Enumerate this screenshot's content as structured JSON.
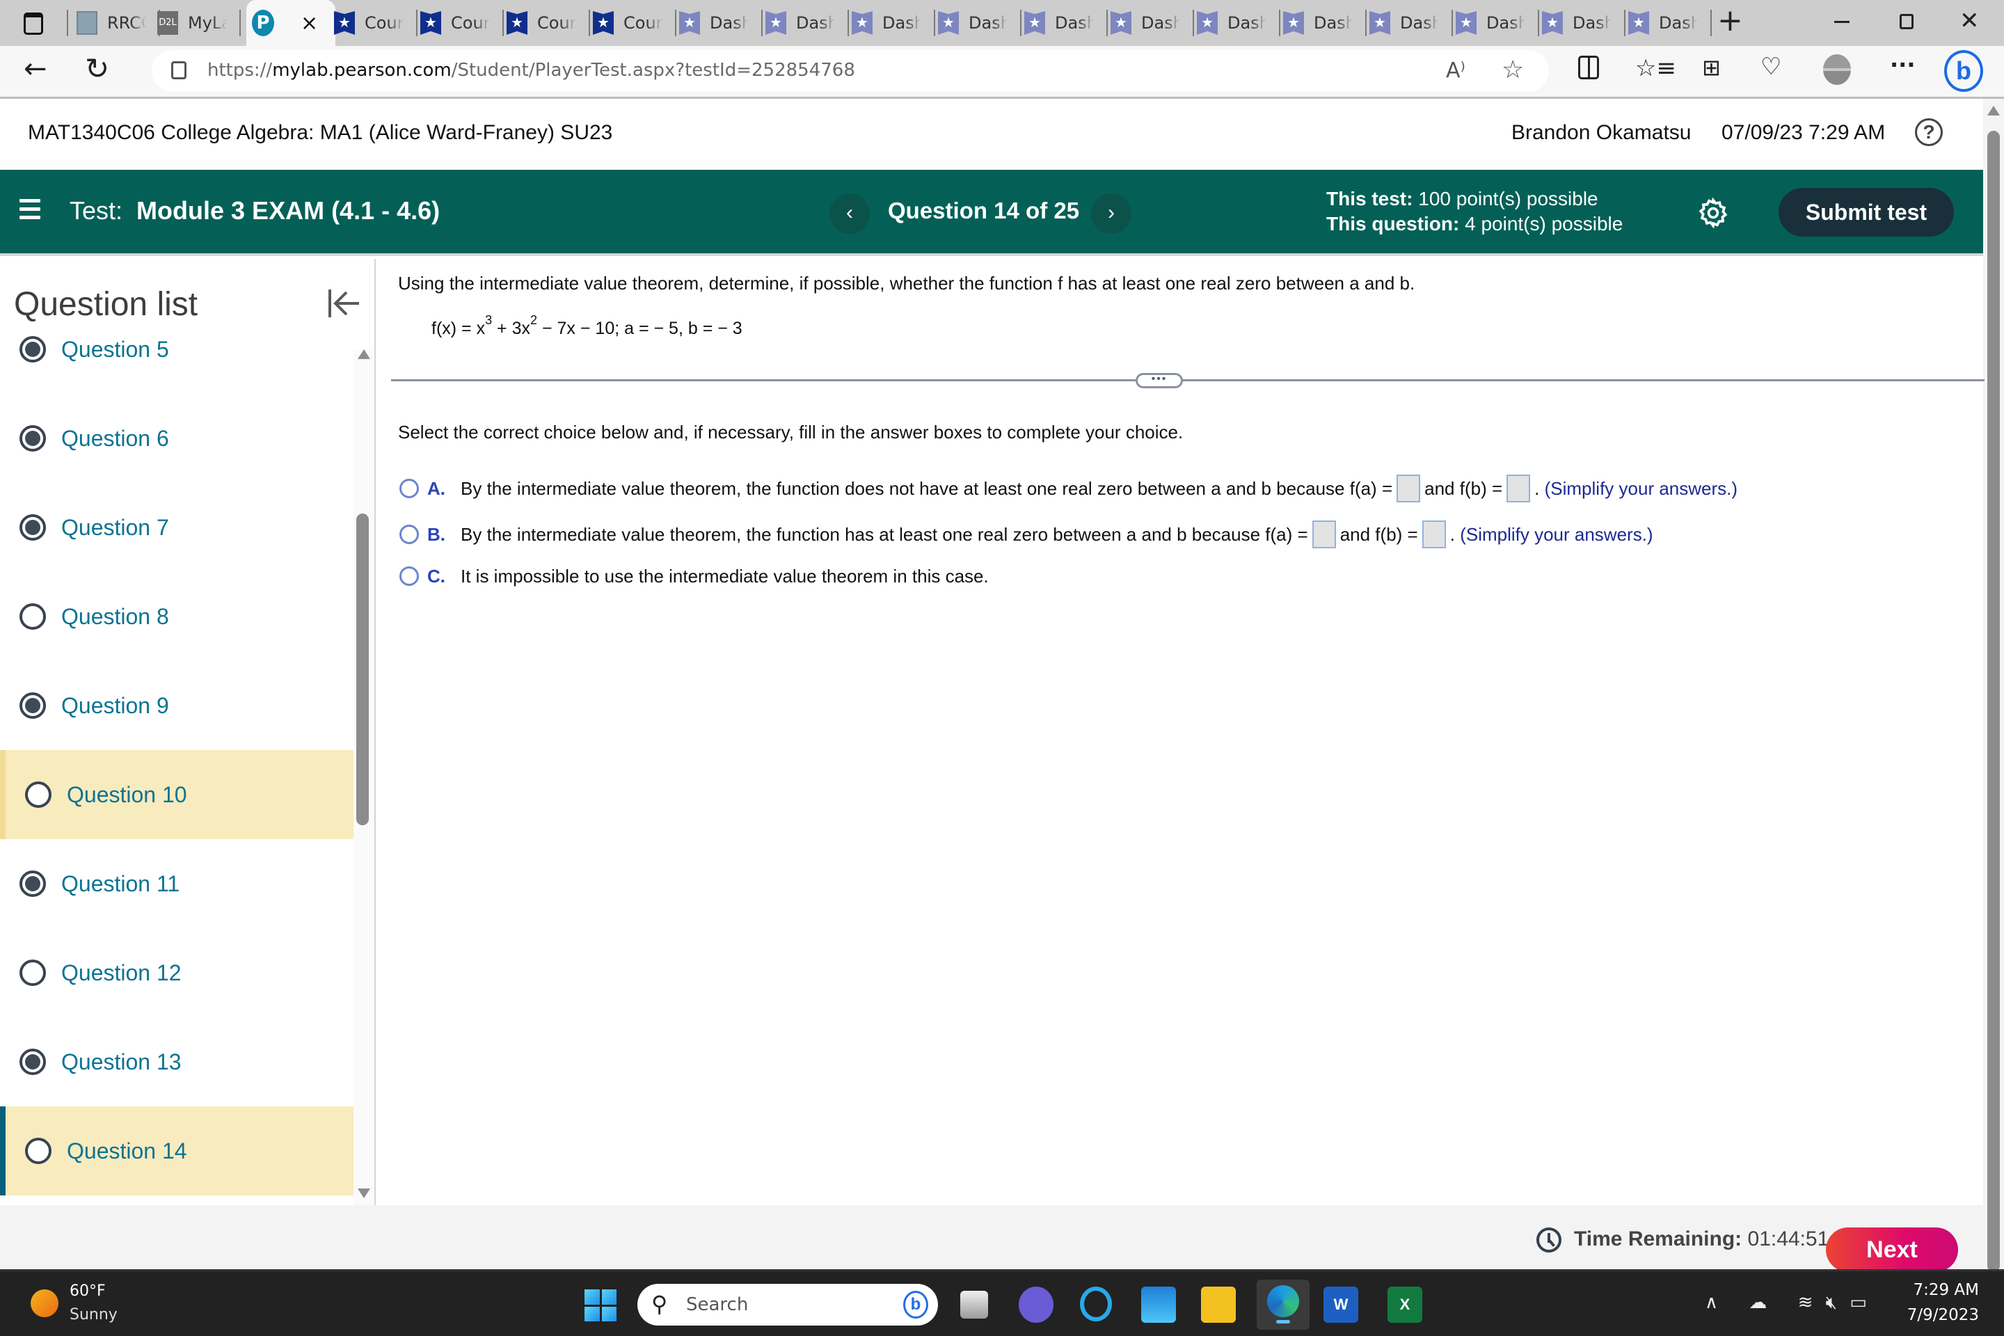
{
  "browser": {
    "tabs": [
      {
        "label": "RRCC",
        "icon": "college-seal-icon"
      },
      {
        "label": "MyLa",
        "icon": "d2l-icon"
      },
      {
        "label": "",
        "icon": "pearson-icon",
        "active": true
      },
      {
        "label": "Cour",
        "icon": "star-badge-icon"
      },
      {
        "label": "Cour",
        "icon": "star-badge-icon"
      },
      {
        "label": "Cour",
        "icon": "star-badge-icon"
      },
      {
        "label": "Cour",
        "icon": "star-badge-icon"
      },
      {
        "label": "Dash",
        "icon": "star-badge-icon"
      },
      {
        "label": "Dash",
        "icon": "star-badge-icon"
      },
      {
        "label": "Dash",
        "icon": "star-badge-icon"
      },
      {
        "label": "Dash",
        "icon": "star-badge-icon"
      },
      {
        "label": "Dash",
        "icon": "star-badge-icon"
      },
      {
        "label": "Dash",
        "icon": "star-badge-icon"
      },
      {
        "label": "Dash",
        "icon": "star-badge-icon"
      },
      {
        "label": "Dash",
        "icon": "star-badge-icon"
      },
      {
        "label": "Dash",
        "icon": "star-badge-icon"
      },
      {
        "label": "Dash",
        "icon": "star-badge-icon"
      },
      {
        "label": "Dash",
        "icon": "star-badge-icon"
      },
      {
        "label": "Dash",
        "icon": "star-badge-icon"
      }
    ],
    "active_tab_close": "×",
    "new_tab": "+",
    "url_prefix": "https://",
    "url_domain": "mylab.pearson.com",
    "url_path": "/Student/PlayerTest.aspx?testId=252854768"
  },
  "header": {
    "course_title": "MAT1340C06 College Algebra: MA1 (Alice Ward-Franey) SU23",
    "user_name": "Brandon Okamatsu",
    "date_time": "07/09/23 7:29 AM",
    "help": "?"
  },
  "testbar": {
    "test_prefix": "Test:",
    "test_name": "Module 3 EXAM (4.1 - 4.6)",
    "prev": "‹",
    "next": "›",
    "question_counter": "Question 14 of 25",
    "this_test_label": "This test:",
    "this_test_value": "100 point(s) possible",
    "this_question_label": "This question:",
    "this_question_value": "4 point(s) possible",
    "submit_label": "Submit test"
  },
  "sidebar": {
    "title": "Question list",
    "questions": [
      {
        "label": "Question 5",
        "answered": true,
        "flagged": false,
        "current": false
      },
      {
        "label": "Question 6",
        "answered": true,
        "flagged": false,
        "current": false
      },
      {
        "label": "Question 7",
        "answered": true,
        "flagged": false,
        "current": false
      },
      {
        "label": "Question 8",
        "answered": false,
        "flagged": false,
        "current": false
      },
      {
        "label": "Question 9",
        "answered": true,
        "flagged": false,
        "current": false
      },
      {
        "label": "Question 10",
        "answered": false,
        "flagged": true,
        "current": false
      },
      {
        "label": "Question 11",
        "answered": true,
        "flagged": false,
        "current": false
      },
      {
        "label": "Question 12",
        "answered": false,
        "flagged": false,
        "current": false
      },
      {
        "label": "Question 13",
        "answered": true,
        "flagged": false,
        "current": false
      },
      {
        "label": "Question 14",
        "answered": false,
        "flagged": false,
        "current": true
      }
    ]
  },
  "question": {
    "instruction": "Using the intermediate value theorem, determine, if possible, whether the function f has at least one real zero between a and b.",
    "function": {
      "lhs": "f(x) = x",
      "exp1": "3",
      "mid": " + 3x",
      "exp2": "2",
      "rest": " − 7x − 10; a = − 5, b = − 3"
    },
    "expand_handle": "•••",
    "select_prompt": "Select the correct choice below and, if necessary, fill in the answer boxes to complete your choice.",
    "choices": [
      {
        "letter": "A.",
        "text": "By the intermediate value theorem, the function does not have at least one real zero between a and b because f(a) =",
        "mid": "and f(b) =",
        "end": ".",
        "hint": "(Simplify your answers.)",
        "fa": "",
        "fb": ""
      },
      {
        "letter": "B.",
        "text": "By the intermediate value theorem, the function has at least one real zero between a and b because f(a) =",
        "mid": "and f(b) =",
        "end": ".",
        "hint": "(Simplify your answers.)",
        "fa": "",
        "fb": ""
      },
      {
        "letter": "C.",
        "text": "It is impossible to use the intermediate value theorem in this case."
      }
    ]
  },
  "footer": {
    "time_label": "Time Remaining:",
    "time_value": "01:44:51",
    "next_label": "Next"
  },
  "taskbar": {
    "temperature": "60°F",
    "condition": "Sunny",
    "search_placeholder": "Search",
    "time": "7:29 AM",
    "date": "7/9/2023"
  },
  "colors": {
    "test_bar": "#046056",
    "submit_button": "#19303a",
    "question_link": "#0b7392",
    "flag_highlight": "#f8ebbe",
    "next_button": "#de0a6a",
    "choice_letter": "#2a45b8"
  }
}
